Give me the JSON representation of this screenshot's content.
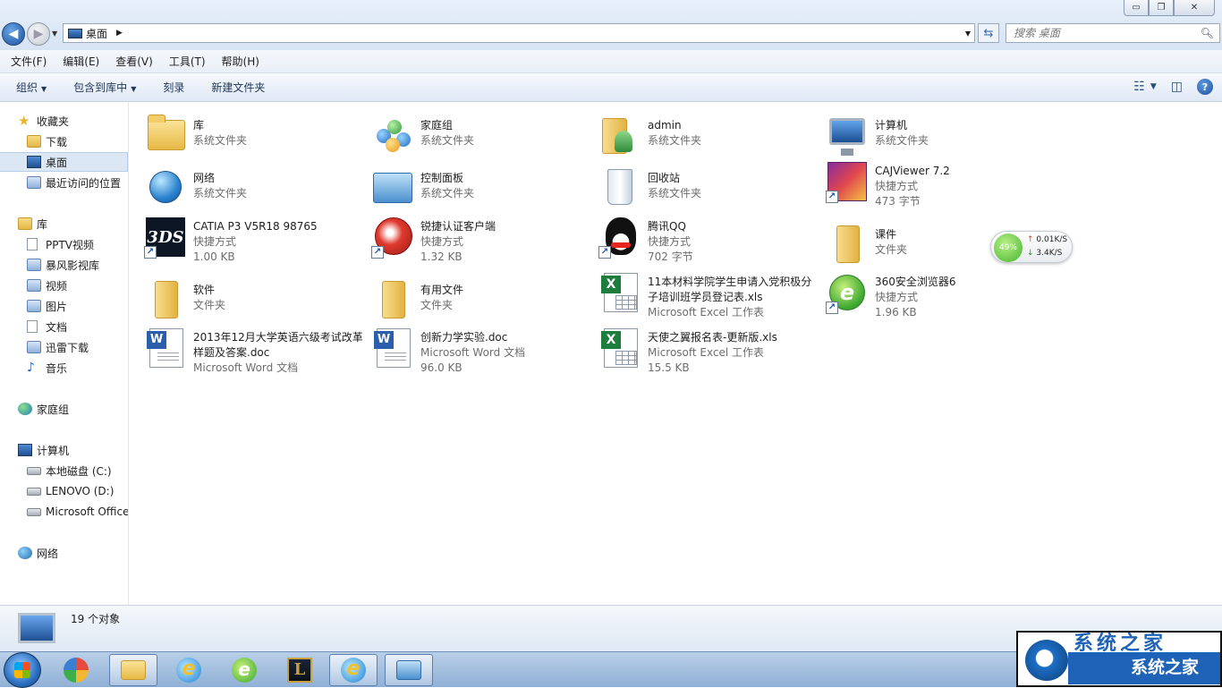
{
  "window": {
    "controls": {
      "minimize": "▭",
      "maximize": "❐",
      "close": "✕"
    }
  },
  "address": {
    "path": "桌面",
    "search_placeholder": "搜索 桌面"
  },
  "menu": [
    "文件(F)",
    "编辑(E)",
    "查看(V)",
    "工具(T)",
    "帮助(H)"
  ],
  "toolbar": {
    "organize": "组织",
    "include_in_library": "包含到库中",
    "burn": "刻录",
    "new_folder": "新建文件夹"
  },
  "nav": {
    "favorites": "收藏夹",
    "downloads": "下载",
    "desktop": "桌面",
    "recent": "最近访问的位置",
    "libraries": "库",
    "pptv": "PPTV视频",
    "baofeng": "暴风影视库",
    "videos": "视频",
    "pictures": "图片",
    "documents": "文档",
    "thunder": "迅雷下载",
    "music": "音乐",
    "homegroup": "家庭组",
    "computer": "计算机",
    "drive_c": "本地磁盘 (C:)",
    "drive_d": "LENOVO (D:)",
    "drive_office": "Microsoft Office",
    "network": "网络"
  },
  "files": [
    {
      "name": "库",
      "meta1": "系统文件夹"
    },
    {
      "name": "家庭组",
      "meta1": "系统文件夹"
    },
    {
      "name": "admin",
      "meta1": "系统文件夹"
    },
    {
      "name": "计算机",
      "meta1": "系统文件夹"
    },
    {
      "name": "网络",
      "meta1": "系统文件夹"
    },
    {
      "name": "控制面板",
      "meta1": "系统文件夹"
    },
    {
      "name": "回收站",
      "meta1": "系统文件夹"
    },
    {
      "name": "CAJViewer 7.2",
      "meta1": "快捷方式",
      "meta2": "473 字节"
    },
    {
      "name": "CATIA P3 V5R18 98765",
      "meta1": "快捷方式",
      "meta2": "1.00 KB"
    },
    {
      "name": "锐捷认证客户端",
      "meta1": "快捷方式",
      "meta2": "1.32 KB"
    },
    {
      "name": "腾讯QQ",
      "meta1": "快捷方式",
      "meta2": "702 字节"
    },
    {
      "name": "课件",
      "meta1": "文件夹"
    },
    {
      "name": "软件",
      "meta1": "文件夹"
    },
    {
      "name": "有用文件",
      "meta1": "文件夹"
    },
    {
      "name": "11本材料学院学生申请入党积极分子培训班学员登记表.xls",
      "meta1": "Microsoft Excel 工作表"
    },
    {
      "name": "360安全浏览器6",
      "meta1": "快捷方式",
      "meta2": "1.96 KB"
    },
    {
      "name": "2013年12月大学英语六级考试改革样题及答案.doc",
      "meta1": "Microsoft Word 文档"
    },
    {
      "name": "创新力学实验.doc",
      "meta1": "Microsoft Word 文档",
      "meta2": "96.0 KB"
    },
    {
      "name": "天使之翼报名表-更新版.xls",
      "meta1": "Microsoft Excel 工作表",
      "meta2": "15.5 KB"
    }
  ],
  "net_widget": {
    "percent": "49%",
    "up": "0.01K/S",
    "down": "3.4K/S"
  },
  "details": {
    "count": "19 个对象"
  },
  "watermark": {
    "text": "系统之家",
    "ghost": "系统之家"
  }
}
